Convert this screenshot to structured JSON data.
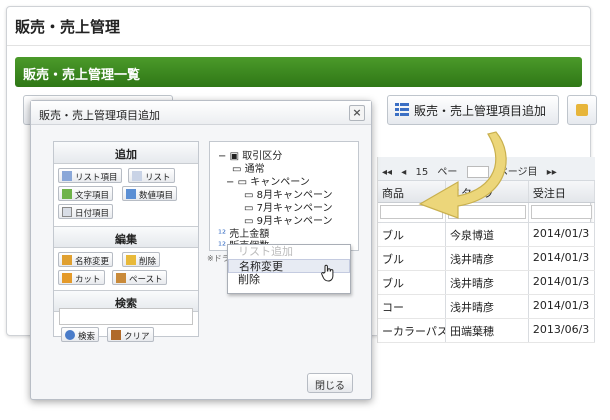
{
  "app_title": "販売・売上管理",
  "section_title": "販売・売上管理一覧",
  "toolbar": {
    "add_item_label": "販売・売上管理項目追加"
  },
  "grid": {
    "pager": {
      "count": "15",
      "page_fragment": "ペー",
      "page_label": "ページ目"
    },
    "columns": [
      "商品",
      "スタッフ",
      "受注日"
    ],
    "rows": [
      [
        "ブル",
        "今泉博道",
        "2014/01/3"
      ],
      [
        "ブル",
        "浅井晴彦",
        "2014/01/3"
      ],
      [
        "ブル",
        "浅井晴彦",
        "2014/01/3"
      ],
      [
        "コー",
        "浅井晴彦",
        "2014/01/3"
      ],
      [
        "ーカラーパスタ",
        "田端葉穂",
        "2013/06/3"
      ]
    ]
  },
  "dialog": {
    "title": "販売・売上管理項目追加",
    "close_x": "×",
    "sections": {
      "add": "追加",
      "edit": "編集",
      "search": "検索"
    },
    "add_buttons": [
      "リスト項目",
      "リスト",
      "文字項目",
      "数値項目",
      "日付項目"
    ],
    "edit_buttons": [
      "名称変更",
      "削除",
      "カット",
      "ペースト"
    ],
    "search_buttons": [
      "検索",
      "クリア"
    ],
    "tree": {
      "root": "取引区分",
      "children": [
        "通常",
        "キャンペーン"
      ],
      "grandchildren": [
        "8月キャンペーン",
        "7月キャンペーン",
        "9月キャンペーン"
      ],
      "siblings": [
        "売上金額",
        "販売個数"
      ]
    },
    "note": "※ドラ",
    "context_menu": [
      "リスト追加",
      "名称変更",
      "削除"
    ],
    "close_button": "閉じる"
  },
  "colors": {
    "green_bar": "#2f7716",
    "arrow": "#ecd67a"
  }
}
